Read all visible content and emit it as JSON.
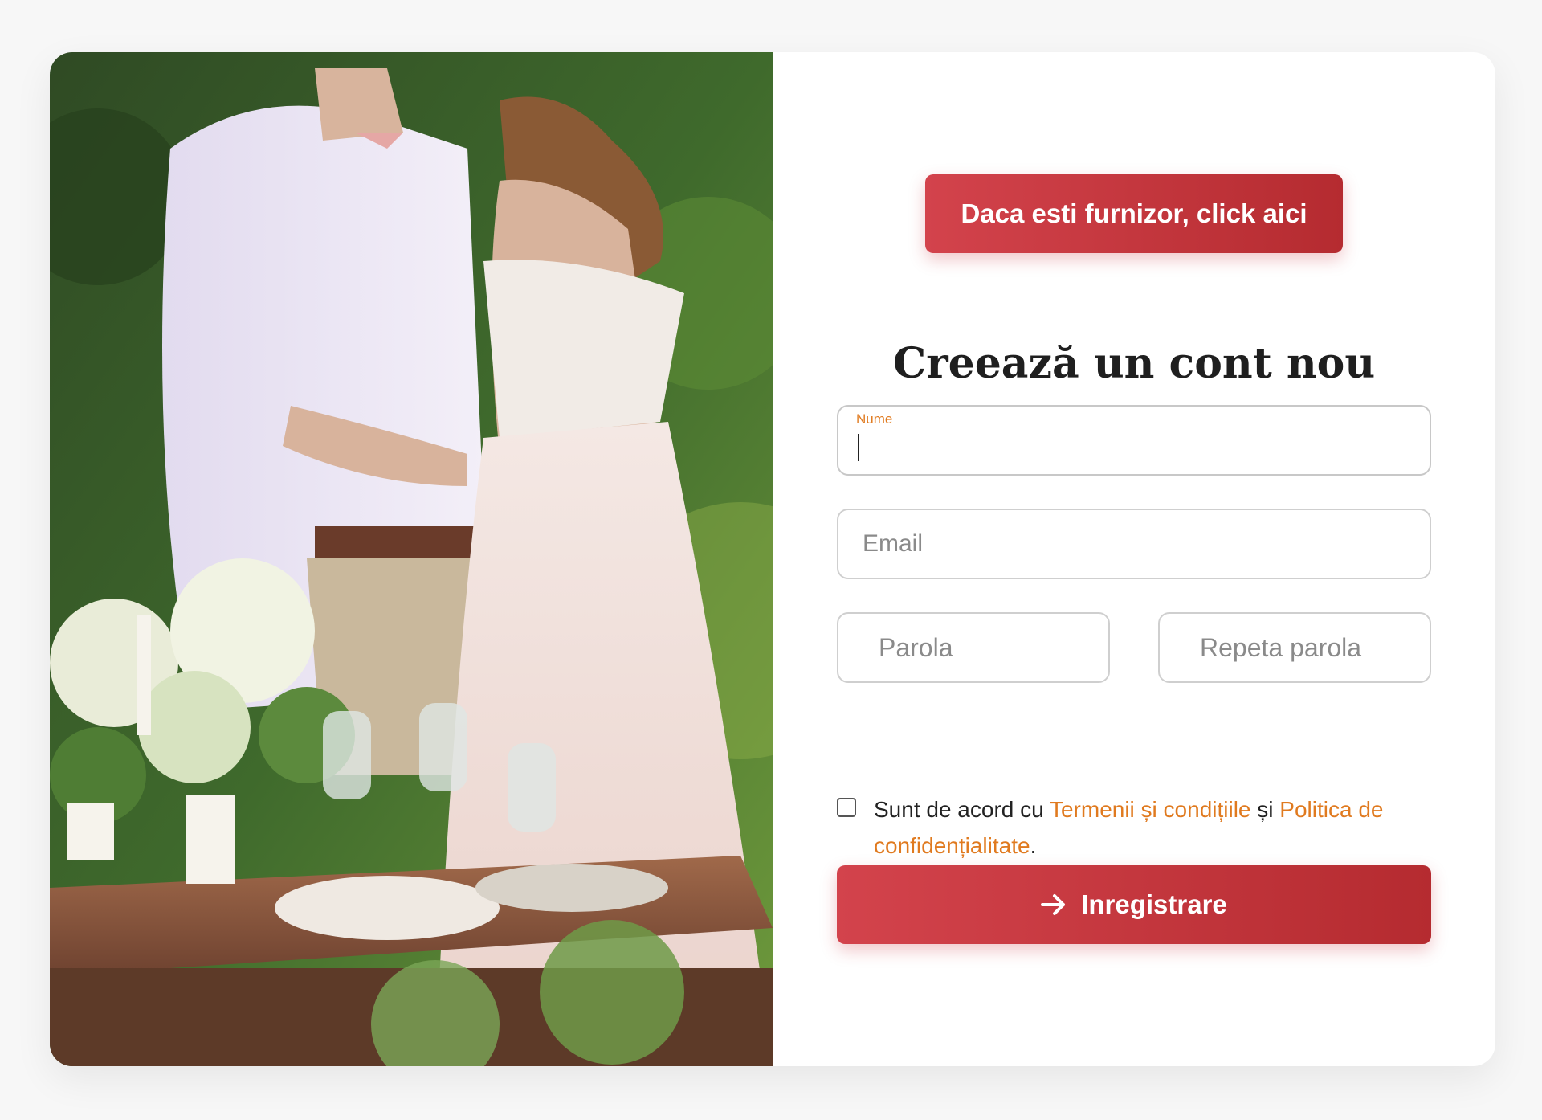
{
  "vendor_button": {
    "label": "Daca esti furnizor, click aici"
  },
  "heading": "Creează un cont nou",
  "fields": {
    "name": {
      "label": "Nume",
      "value": ""
    },
    "email": {
      "placeholder": "Email"
    },
    "password": {
      "placeholder": "Parola"
    },
    "repeat_password": {
      "placeholder": "Repeta parola"
    }
  },
  "consent": {
    "checked": false,
    "prefix": "Sunt de acord cu ",
    "terms_link": "Termenii și condițiile",
    "conjunction": " și ",
    "privacy_link": "Politica de confidențialitate",
    "suffix": "."
  },
  "submit_button": {
    "label": "Inregistrare",
    "icon": "arrow-right-icon"
  },
  "colors": {
    "brand_red": "#c93a42",
    "link_orange": "#e07a1f",
    "heading_text": "#1f1f1f",
    "page_bg": "#f7f7f7"
  }
}
